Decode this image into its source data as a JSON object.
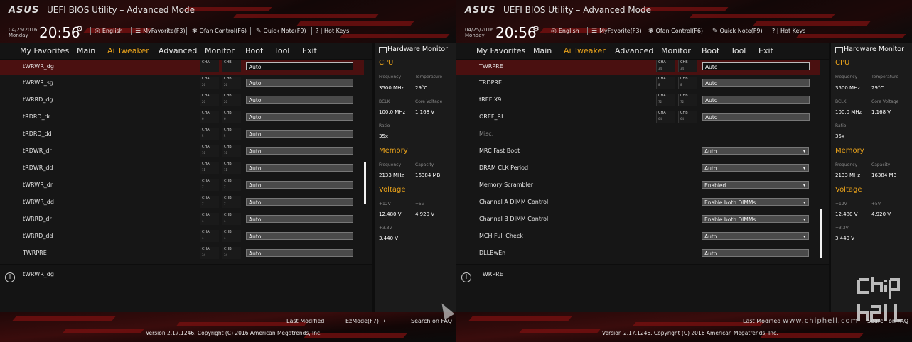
{
  "header": {
    "logo": "ASUS",
    "title": "UEFI BIOS Utility – Advanced Mode",
    "date": "04/25/2016",
    "day": "Monday",
    "time": "20:56",
    "toolbar": {
      "language": "English",
      "myfavorite": "MyFavorite(F3)",
      "qfan": "Qfan Control(F6)",
      "quicknote": "Quick Note(F9)",
      "hotkeys": "? | Hot Keys"
    }
  },
  "menu": [
    "My Favorites",
    "Main",
    "Ai Tweaker",
    "Advanced",
    "Monitor",
    "Boot",
    "Tool",
    "Exit"
  ],
  "active_menu": "Ai Tweaker",
  "mini_header": {
    "a": "CHA",
    "b": "CHB"
  },
  "left_list": [
    {
      "label": "tWRWR_dg",
      "a": "",
      "b": "",
      "value": "Auto",
      "selected": true
    },
    {
      "label": "tWRWR_sg",
      "a": "26",
      "b": "26",
      "value": "Auto"
    },
    {
      "label": "tWRRD_dg",
      "a": "20",
      "b": "20",
      "value": "Auto"
    },
    {
      "label": "tRDRD_dr",
      "a": "6",
      "b": "6",
      "value": "Auto"
    },
    {
      "label": "tRDRD_dd",
      "a": "5",
      "b": "5",
      "value": "Auto"
    },
    {
      "label": "tRDWR_dr",
      "a": "10",
      "b": "10",
      "value": "Auto"
    },
    {
      "label": "tRDWR_dd",
      "a": "11",
      "b": "11",
      "value": "Auto"
    },
    {
      "label": "tWRWR_dr",
      "a": "7",
      "b": "7",
      "value": "Auto"
    },
    {
      "label": "tWRWR_dd",
      "a": "7",
      "b": "7",
      "value": "Auto"
    },
    {
      "label": "tWRRD_dr",
      "a": "4",
      "b": "4",
      "value": "Auto"
    },
    {
      "label": "tWRRD_dd",
      "a": "4",
      "b": "4",
      "value": "Auto"
    },
    {
      "label": "TWRPRE",
      "a": "34",
      "b": "34",
      "value": "Auto"
    }
  ],
  "right_list": [
    {
      "label": "TWRPRE",
      "a": "34",
      "b": "34",
      "value": "Auto",
      "selected": true
    },
    {
      "label": "TRDPRE",
      "a": "8",
      "b": "8",
      "value": "Auto"
    },
    {
      "label": "tREFIX9",
      "a": "72",
      "b": "72",
      "value": "Auto"
    },
    {
      "label": "OREF_RI",
      "a": "64",
      "b": "64",
      "value": "Auto"
    },
    {
      "label": "Misc.",
      "section": true
    },
    {
      "label": "MRC Fast Boot",
      "value": "Auto",
      "dropdown": true
    },
    {
      "label": "DRAM CLK Period",
      "value": "Auto",
      "dropdown": true
    },
    {
      "label": "Memory Scrambler",
      "value": "Enabled",
      "dropdown": true
    },
    {
      "label": "Channel A DIMM Control",
      "value": "Enable both DIMMs",
      "dropdown": true
    },
    {
      "label": "Channel B DIMM Control",
      "value": "Enable both DIMMs",
      "dropdown": true
    },
    {
      "label": "MCH Full Check",
      "value": "Auto",
      "dropdown": true
    },
    {
      "label": "DLLBwEn",
      "value": "Auto",
      "dropdown": false
    }
  ],
  "info": {
    "left": "tWRWR_dg",
    "right": "TWRPRE"
  },
  "hardware_monitor": {
    "title": "Hardware Monitor",
    "cpu": {
      "heading": "CPU",
      "freq_label": "Frequency",
      "freq": "3500 MHz",
      "temp_label": "Temperature",
      "temp": "29°C",
      "bclk_label": "BCLK",
      "bclk": "100.0 MHz",
      "vcore_label": "Core Voltage",
      "vcore": "1.168 V",
      "ratio_label": "Ratio",
      "ratio": "35x"
    },
    "memory": {
      "heading": "Memory",
      "freq_label": "Frequency",
      "freq": "2133 MHz",
      "cap_label": "Capacity",
      "cap": "16384 MB"
    },
    "voltage": {
      "heading": "Voltage",
      "v12_label": "+12V",
      "v12": "12.480 V",
      "v5_label": "+5V",
      "v5": "4.920 V",
      "v33_label": "+3.3V",
      "v33": "3.440 V"
    }
  },
  "footer": {
    "last_modified": "Last Modified",
    "ezmode": "EzMode(F7)|→",
    "search": "Search on FAQ",
    "version": "Version 2.17.1246. Copyright (C) 2016 American Megatrends, Inc.",
    "watermark_url": "www.chiphell.com",
    "watermark_logo": "chip hell"
  },
  "colors": {
    "accent": "#e9a21b",
    "selected_row": "#4a1010",
    "field": "#4a4a4a"
  }
}
